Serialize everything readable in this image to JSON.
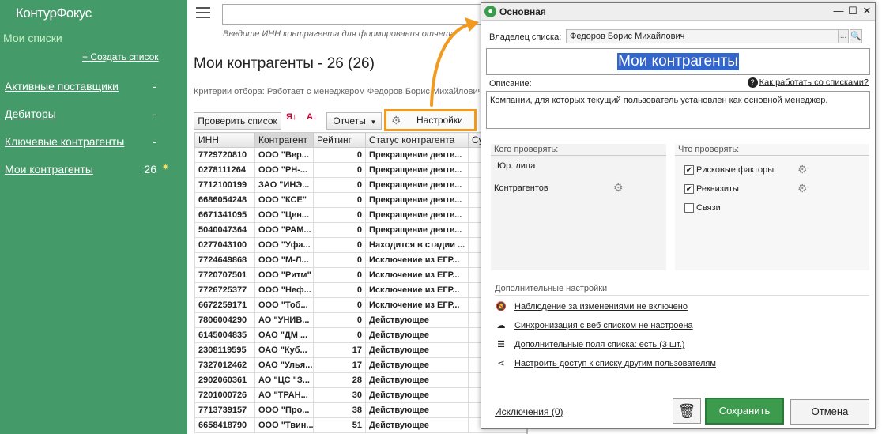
{
  "app": {
    "logo": "КонтурФокус"
  },
  "sidebar": {
    "title": "Мои списки",
    "create_label": "+ Создать список",
    "items": [
      {
        "label": "Активные поставщики",
        "count": "-"
      },
      {
        "label": "Дебиторы",
        "count": "-"
      },
      {
        "label": "Ключевые контрагенты",
        "count": "-"
      },
      {
        "label": "Мои контрагенты",
        "count": "26"
      }
    ]
  },
  "header": {
    "search_value": "",
    "search_hint": "Введите ИНН контрагента для формирования отчета"
  },
  "main": {
    "title": "Мои контрагенты - 26 (26)",
    "criteria": "Критерии отбора: Работает с менеджером Федоров Борис Михайлович",
    "toolbar": {
      "check_label": "Проверить список",
      "reports_label": "Отчеты",
      "reports_arrow": "▾",
      "settings_label": "Настройки",
      "sort_asc": "Я↓",
      "sort_desc": "А↓"
    },
    "table": {
      "columns": [
        "ИНН",
        "Контрагент",
        "Рейтинг",
        "Статус контрагента",
        "Су"
      ],
      "rows": [
        [
          "7729720810",
          "ООО \"Вер...",
          "0",
          "Прекращение деяте..."
        ],
        [
          "0278111264",
          "ООО \"РН-...",
          "0",
          "Прекращение деяте..."
        ],
        [
          "7712100199",
          "ЗАО \"ИНЭ...",
          "0",
          "Прекращение деяте..."
        ],
        [
          "6686054248",
          "ООО \"КСЕ\"",
          "0",
          "Прекращение деяте..."
        ],
        [
          "6671341095",
          "ООО \"Цен...",
          "0",
          "Прекращение деяте..."
        ],
        [
          "5040047364",
          "ООО \"РАМ...",
          "0",
          "Прекращение деяте..."
        ],
        [
          "0277043100",
          "ООО \"Уфа...",
          "0",
          "Находится в стадии ..."
        ],
        [
          "7724649868",
          "ООО \"М-Л...",
          "0",
          "Исключение из ЕГР..."
        ],
        [
          "7720707501",
          "ООО \"Ритм\"",
          "0",
          "Исключение из ЕГР..."
        ],
        [
          "7726725377",
          "ООО \"Неф...",
          "0",
          "Исключение из ЕГР..."
        ],
        [
          "6672259171",
          "ООО \"Тоб...",
          "0",
          "Исключение из ЕГР..."
        ],
        [
          "7806004290",
          "АО \"УНИВ...",
          "0",
          "Действующее"
        ],
        [
          "6145004835",
          "ОАО \"ДМ ...",
          "0",
          "Действующее"
        ],
        [
          "2308119595",
          "ОАО \"Куб...",
          "17",
          "Действующее"
        ],
        [
          "7327012462",
          "ОАО \"Улья...",
          "17",
          "Действующее"
        ],
        [
          "2902060361",
          "АО \"ЦС \"З...",
          "28",
          "Действующее"
        ],
        [
          "7201000726",
          "АО \"ТРАН...",
          "30",
          "Действующее"
        ],
        [
          "7713739157",
          "ООО \"Про...",
          "38",
          "Действующее"
        ],
        [
          "6658418790",
          "ООО \"Твин...",
          "51",
          "Действующее"
        ]
      ]
    }
  },
  "dialog": {
    "title": "Основная",
    "window_buttons": {
      "minimize": "—",
      "maximize": "☐",
      "close": "✕"
    },
    "owner_label": "Владелец списка:",
    "owner_value": "Федоров Борис Михайлович",
    "owner_dots": "...",
    "list_name": "Мои контрагенты",
    "description_label": "Описание:",
    "help_link": "Как работать со списками?",
    "description": "Компании, для которых текущий пользователь установлен как основной менеджер.",
    "who_title": "Кого проверять:",
    "who_items": [
      "Юр. лица",
      "Контрагентов"
    ],
    "what_title": "Что проверять:",
    "what_items": [
      {
        "label": "Рисковые факторы",
        "checked": true
      },
      {
        "label": "Реквизиты",
        "checked": true
      },
      {
        "label": "Связи",
        "checked": false
      }
    ],
    "extra_title": "Дополнительные настройки",
    "extra_items": [
      {
        "icon": "bell-off-icon",
        "glyph": "🔕",
        "label": "Наблюдение за изменениями не включено"
      },
      {
        "icon": "cloud-alert-icon",
        "glyph": "☁",
        "label": "Синхронизация с веб списком не настроена"
      },
      {
        "icon": "list-add-icon",
        "glyph": "☰",
        "label": "Дополнительные поля списка: есть (3 шт.)"
      },
      {
        "icon": "share-icon",
        "glyph": "⋖",
        "label": "Настроить доступ к списку другим пользователям"
      }
    ],
    "exclusions_label": "Исключения (0)",
    "save_label": "Сохранить",
    "cancel_label": "Отмена"
  },
  "colors": {
    "sidebar_bg": "#459a69",
    "accent_orange": "#f29a1f",
    "save_green": "#3c9b4c",
    "selection_blue": "#3366cc"
  }
}
